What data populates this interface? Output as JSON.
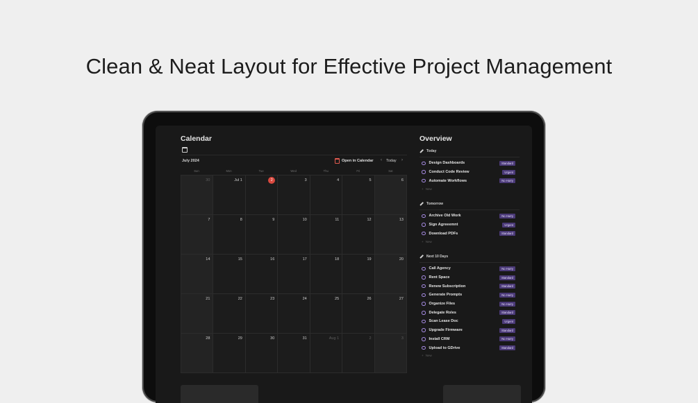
{
  "headline": "Clean & Neat Layout for Effective Project Management",
  "calendar": {
    "title": "Calendar",
    "month": "July 2024",
    "open_label": "Open in Calendar",
    "today_label": "Today",
    "prev": "‹",
    "next": "›",
    "weekdays": [
      "Sun",
      "Mon",
      "Tue",
      "Wed",
      "Thu",
      "Fri",
      "Sat"
    ],
    "weeks": [
      [
        {
          "d": "30",
          "m": true
        },
        {
          "d": "Jul 1"
        },
        {
          "d": "2",
          "t": true
        },
        {
          "d": "3"
        },
        {
          "d": "4"
        },
        {
          "d": "5"
        },
        {
          "d": "6"
        }
      ],
      [
        {
          "d": "7"
        },
        {
          "d": "8"
        },
        {
          "d": "9"
        },
        {
          "d": "10"
        },
        {
          "d": "11"
        },
        {
          "d": "12"
        },
        {
          "d": "13"
        }
      ],
      [
        {
          "d": "14"
        },
        {
          "d": "15"
        },
        {
          "d": "16"
        },
        {
          "d": "17"
        },
        {
          "d": "18"
        },
        {
          "d": "19"
        },
        {
          "d": "20"
        }
      ],
      [
        {
          "d": "21"
        },
        {
          "d": "22"
        },
        {
          "d": "23"
        },
        {
          "d": "24"
        },
        {
          "d": "25"
        },
        {
          "d": "26"
        },
        {
          "d": "27"
        }
      ],
      [
        {
          "d": "28"
        },
        {
          "d": "29"
        },
        {
          "d": "30"
        },
        {
          "d": "31"
        },
        {
          "d": "Aug 1",
          "m": true
        },
        {
          "d": "2",
          "m": true
        },
        {
          "d": "3",
          "m": true
        }
      ]
    ]
  },
  "overview": {
    "title": "Overview",
    "new_label": "New",
    "groups": [
      {
        "name": "Today",
        "tasks": [
          {
            "label": "Design Dashboards",
            "tag": "Standard"
          },
          {
            "label": "Conduct Code Review",
            "tag": "Urgent"
          },
          {
            "label": "Automate Workflows",
            "tag": "No Hurry"
          }
        ]
      },
      {
        "name": "Tomorrow",
        "tasks": [
          {
            "label": "Archive Old Work",
            "tag": "No Hurry"
          },
          {
            "label": "Sign Agreeemnt",
            "tag": "Urgent"
          },
          {
            "label": "Download PDFs",
            "tag": "Standard"
          }
        ]
      },
      {
        "name": "Next 10 Days",
        "tasks": [
          {
            "label": "Call Agency",
            "tag": "No Hurry"
          },
          {
            "label": "Rent Space",
            "tag": "Standard"
          },
          {
            "label": "Renew Subscription",
            "tag": "Standard"
          },
          {
            "label": "Generate Prompts",
            "tag": "No Hurry"
          },
          {
            "label": "Organize Files",
            "tag": "No Hurry"
          },
          {
            "label": "Delegate Roles",
            "tag": "Standard"
          },
          {
            "label": "Scan Lease Doc",
            "tag": "Urgent"
          },
          {
            "label": "Upgrade Firmware",
            "tag": "Standard"
          },
          {
            "label": "Install CRM",
            "tag": "No Hurry"
          },
          {
            "label": "Upload to GDrive",
            "tag": "Standard"
          }
        ]
      }
    ]
  }
}
